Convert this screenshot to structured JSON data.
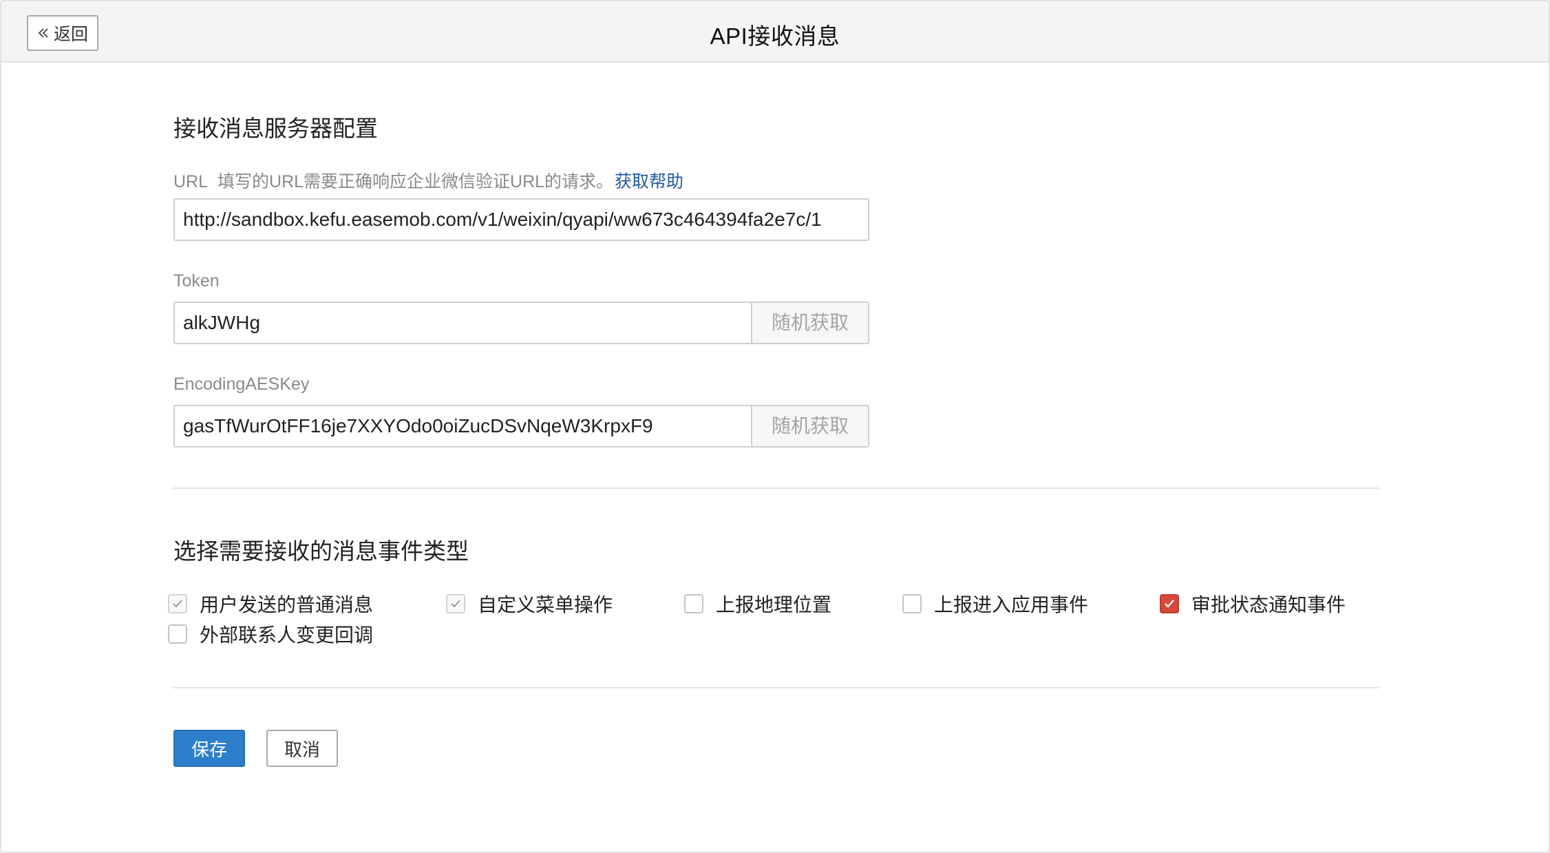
{
  "header": {
    "back_label": "返回",
    "title": "API接收消息"
  },
  "server_config": {
    "title": "接收消息服务器配置",
    "url_label": "URL",
    "url_hint": "填写的URL需要正确响应企业微信验证URL的请求。",
    "url_help": "获取帮助",
    "url_value": "http://sandbox.kefu.easemob.com/v1/weixin/qyapi/ww673c464394fa2e7c/1",
    "token_label": "Token",
    "token_value": "alkJWHg",
    "token_random": "随机获取",
    "aes_label": "EncodingAESKey",
    "aes_value": "gasTfWurOtFF16je7XXYOdo0oiZucDSvNqeW3KrpxF9",
    "aes_random": "随机获取"
  },
  "events": {
    "title": "选择需要接收的消息事件类型",
    "items": [
      {
        "label": "用户发送的普通消息",
        "state": "disabled-checked"
      },
      {
        "label": "自定义菜单操作",
        "state": "disabled-checked"
      },
      {
        "label": "上报地理位置",
        "state": "unchecked"
      },
      {
        "label": "上报进入应用事件",
        "state": "unchecked"
      },
      {
        "label": "审批状态通知事件",
        "state": "checked"
      },
      {
        "label": "外部联系人变更回调",
        "state": "unchecked"
      }
    ]
  },
  "actions": {
    "save_label": "保存",
    "cancel_label": "取消"
  },
  "colors": {
    "primary": "#2d7fcb",
    "link": "#1f5a9e",
    "checked": "#d44a3a"
  }
}
